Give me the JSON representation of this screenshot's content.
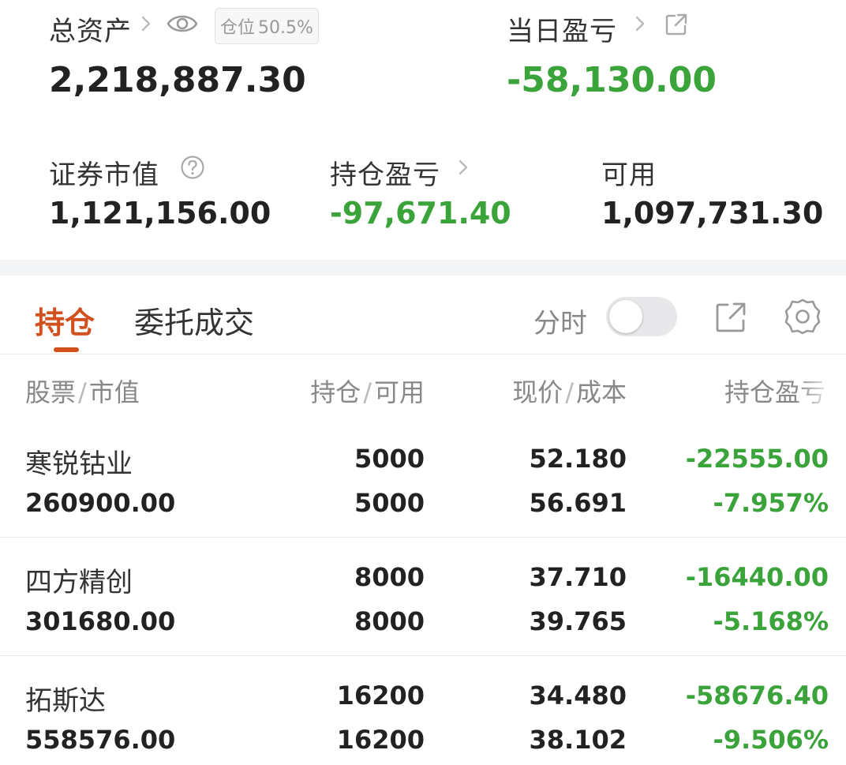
{
  "summary": {
    "total_assets_label": "总资产",
    "position_ratio_label": "仓位",
    "position_ratio_value": "50.5%",
    "total_assets_value": "2,218,887.30",
    "daily_pnl_label": "当日盈亏",
    "daily_pnl_value": "-58,130.00",
    "market_value_label": "证券市值",
    "market_value_value": "1,121,156.00",
    "holding_pnl_label": "持仓盈亏",
    "holding_pnl_value": "-97,671.40",
    "available_label": "可用",
    "available_value": "1,097,731.30"
  },
  "tabs": [
    {
      "label": "持仓",
      "active": true
    },
    {
      "label": "委托成交",
      "active": false
    }
  ],
  "toolbar": {
    "intraday_label": "分时",
    "intraday_on": false
  },
  "table": {
    "headers": [
      {
        "a": "股票",
        "b": "市值"
      },
      {
        "a": "持仓",
        "b": "可用"
      },
      {
        "a": "现价",
        "b": "成本"
      },
      {
        "a": "持仓盈亏",
        "b": ""
      }
    ],
    "rows": [
      {
        "name": "寒锐钴业",
        "market_value": "260900.00",
        "holding": "5000",
        "available": "5000",
        "price": "52.180",
        "cost": "56.691",
        "pnl": "-22555.00",
        "pnl_pct": "-7.957%"
      },
      {
        "name": "四方精创",
        "market_value": "301680.00",
        "holding": "8000",
        "available": "8000",
        "price": "37.710",
        "cost": "39.765",
        "pnl": "-16440.00",
        "pnl_pct": "-5.168%"
      },
      {
        "name": "拓斯达",
        "market_value": "558576.00",
        "holding": "16200",
        "available": "16200",
        "price": "34.480",
        "cost": "38.102",
        "pnl": "-58676.40",
        "pnl_pct": "-9.506%"
      }
    ]
  },
  "colors": {
    "accent": "#d2501e",
    "loss": "#3aa33a",
    "text": "#222222",
    "muted": "#888888"
  },
  "icons": [
    "chevron-right-icon",
    "eye-icon",
    "external-link-icon",
    "question-icon",
    "share-icon",
    "settings-icon"
  ]
}
